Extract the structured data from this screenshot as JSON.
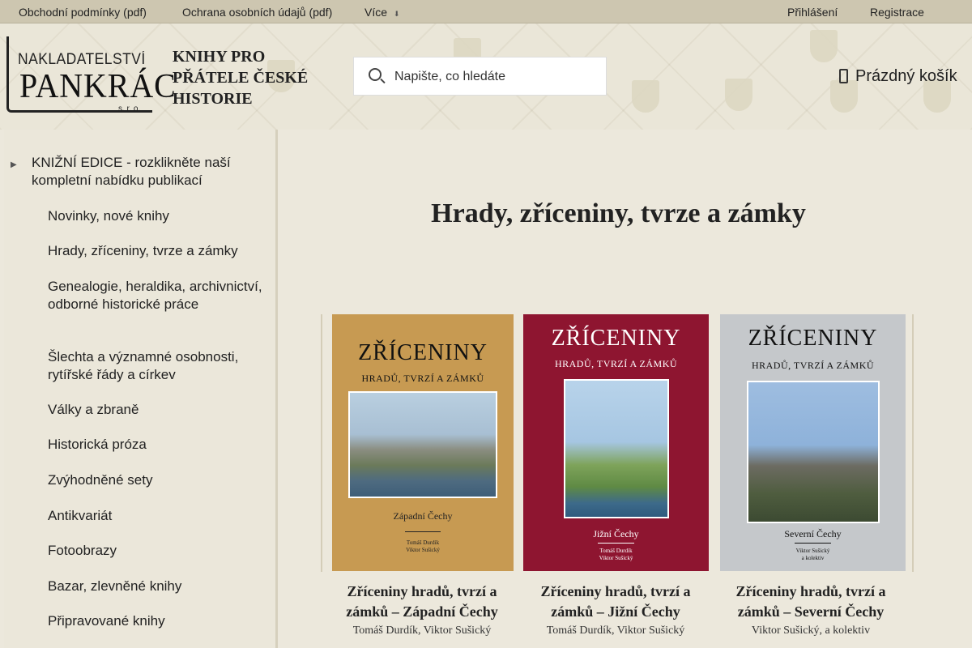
{
  "topbar": {
    "links": [
      "Obchodní podmínky (pdf)",
      "Ochrana osobních údajů (pdf)",
      "Více"
    ],
    "login": "Přihlášení",
    "register": "Registrace"
  },
  "header": {
    "logo_top": "NAKLADATELSTVÍ",
    "logo_big": "PANKRÁC",
    "logo_sro": "s. r. o.",
    "tagline": "KNIHY PRO PŘÁTELE ČESKÉ HISTORIE",
    "search_placeholder": "Napište, co hledáte",
    "cart": "Prázdný košík"
  },
  "sidebar": {
    "heading": "KNIŽNÍ EDICE - rozklikněte naší kompletní nabídku publikací",
    "items": [
      "Novinky, nové knihy",
      "Hrady, zříceniny, tvrze a zámky",
      "Genealogie, heraldika, archivnictví, odborné historické práce",
      "Šlechta a významné osobnosti, rytířské řády a církev",
      "Války a zbraně",
      "Historická próza",
      "Zvýhodněné sety",
      "Antikvariát",
      "Fotoobrazy",
      "Bazar, zlevněné knihy",
      "Připravované knihy"
    ]
  },
  "main": {
    "title": "Hrady, zříceniny, tvrze a zámky",
    "products": [
      {
        "name": "Zříceniny hradů, tvrzí a zámků – Západní Čechy",
        "author": "Tomáš Durdík, Viktor Sušický",
        "cover_title": "ZŘÍCENINY",
        "cover_sub": "HRADŮ, TVRZÍ A ZÁMKŮ",
        "cover_region": "Západní Čechy",
        "cover_authors": "Tomáš Durdík\nViktor Sušický",
        "cover_color": "#c79a52"
      },
      {
        "name": "Zříceniny hradů, tvrzí a zámků – Jižní Čechy",
        "author": "Tomáš Durdík, Viktor Sušický",
        "cover_title": "ZŘÍCENINY",
        "cover_sub": "HRADŮ, TVRZÍ A ZÁMKŮ",
        "cover_region": "Jižní Čechy",
        "cover_authors": "Tomáš Durdík\nViktor Sušický",
        "cover_color": "#8e1530"
      },
      {
        "name": "Zříceniny hradů, tvrzí a zámků – Severní Čechy",
        "author": "Viktor Sušický, a kolektiv",
        "cover_title": "ZŘÍCENINY",
        "cover_sub": "HRADŮ, TVRZÍ A ZÁMKŮ",
        "cover_region": "Severní Čechy",
        "cover_authors": "Viktor Sušický\na kolektiv",
        "cover_color": "#c5c8cb"
      }
    ]
  }
}
